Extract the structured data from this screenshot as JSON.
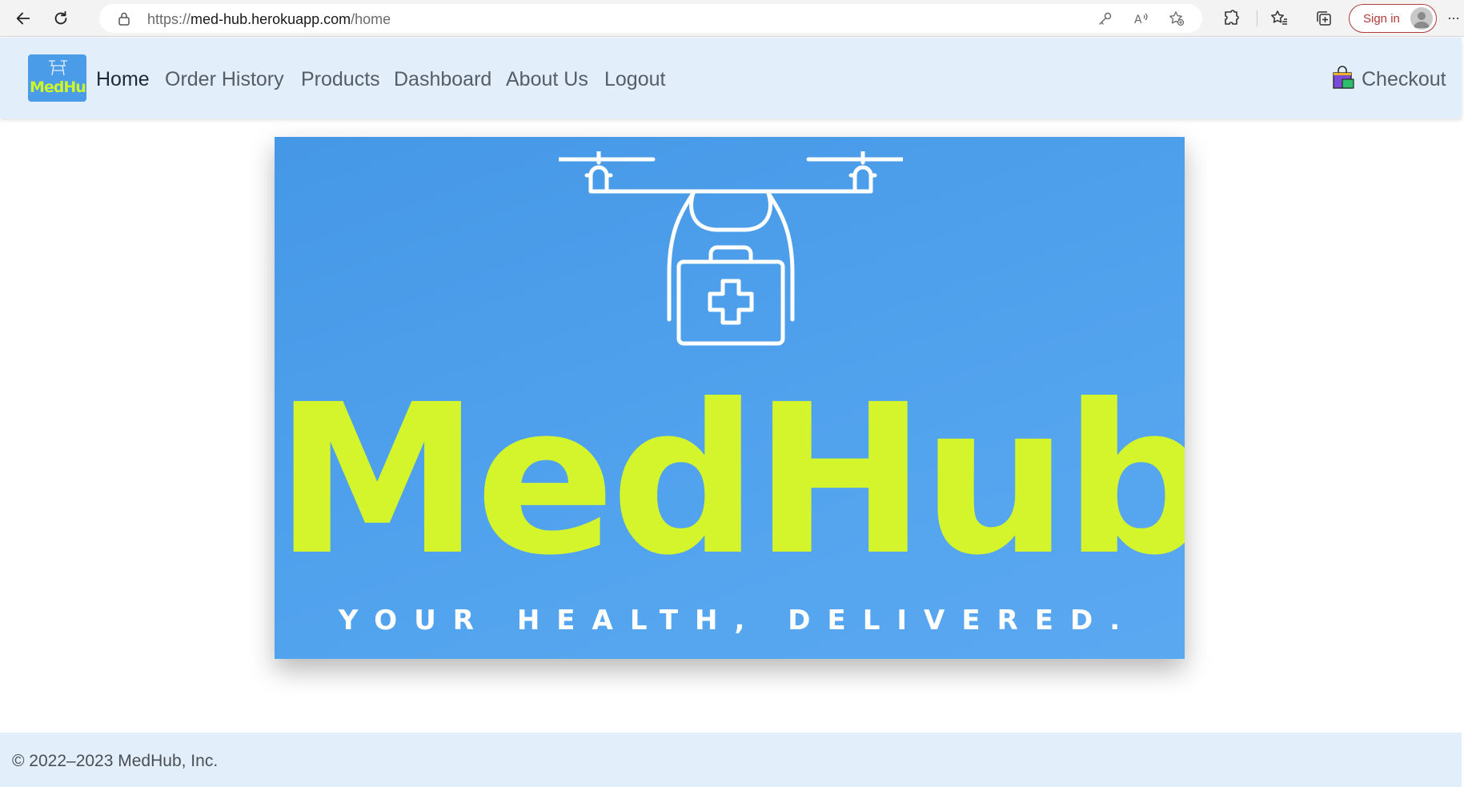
{
  "browser": {
    "url_scheme": "https://",
    "url_host": "med-hub.herokuapp.com",
    "url_path": "/home",
    "signin_label": "Sign in",
    "more_label": "···"
  },
  "nav": {
    "links": [
      {
        "label": "Home",
        "active": true
      },
      {
        "label": "Order History"
      },
      {
        "label": "Products"
      },
      {
        "label": "Dashboard"
      },
      {
        "label": "About Us"
      },
      {
        "label": "Logout"
      }
    ],
    "checkout_label": "Checkout",
    "logo_text": "MedHub"
  },
  "hero": {
    "wordmark": "MedHub",
    "tagline": "YOUR HEALTH, DELIVERED."
  },
  "footer": {
    "copyright": "© 2022–2023 MedHub, Inc."
  },
  "icons": {
    "back": "back-arrow-icon",
    "refresh": "refresh-icon",
    "lock": "lock-icon",
    "checkout": "shopping-bag-icon"
  },
  "colors": {
    "navbar_bg": "#e3eefb",
    "hero_bg": "#4a9de9",
    "wordmark": "#d4f52c",
    "signin_accent": "#b23a3a"
  }
}
